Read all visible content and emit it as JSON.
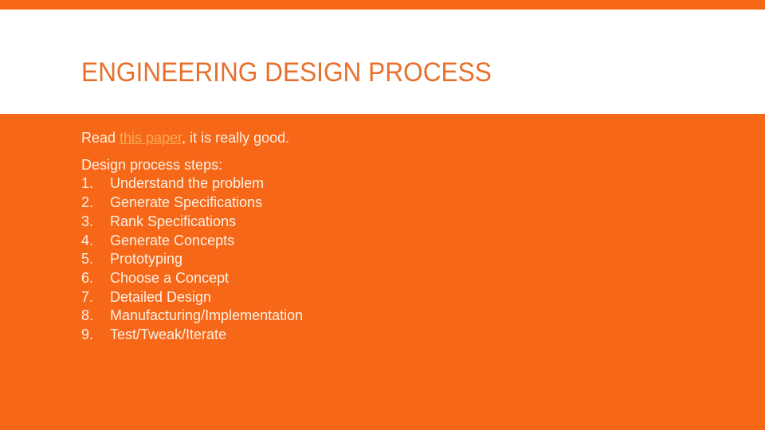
{
  "colors": {
    "background": "#F66718",
    "title_band": "#FFFFFF",
    "title_text": "#E8702C",
    "body_text": "#FCF0E2",
    "link": "#F9AE55"
  },
  "slide": {
    "title": "ENGINEERING DESIGN PROCESS",
    "intro": {
      "before": "Read ",
      "link_text": "this paper",
      "after": ", it is really good."
    },
    "steps_heading": "Design process steps:",
    "steps": [
      {
        "num": "1.",
        "label": "Understand the problem"
      },
      {
        "num": "2.",
        "label": "Generate Specifications"
      },
      {
        "num": "3.",
        "label": "Rank Specifications"
      },
      {
        "num": "4.",
        "label": "Generate Concepts"
      },
      {
        "num": "5.",
        "label": "Prototyping"
      },
      {
        "num": "6.",
        "label": "Choose a Concept"
      },
      {
        "num": "7.",
        "label": "Detailed Design"
      },
      {
        "num": "8.",
        "label": "Manufacturing/Implementation"
      },
      {
        "num": "9.",
        "label": "Test/Tweak/Iterate"
      }
    ]
  }
}
